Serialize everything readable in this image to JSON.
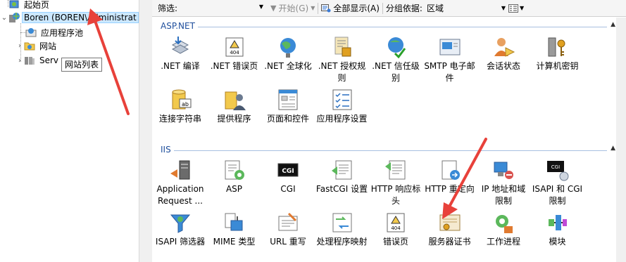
{
  "tree": {
    "items": [
      {
        "label": "起始页",
        "expanded": null
      },
      {
        "label": "Boren (BOREN\\Administrat",
        "expanded": true,
        "selected": true
      },
      {
        "label": "应用程序池",
        "expanded": null
      },
      {
        "label": "网站",
        "expanded": false
      },
      {
        "label": "Serv",
        "expanded": false
      }
    ],
    "tooltip": "网站列表"
  },
  "toolbar": {
    "filter_label": "筛选:",
    "go_label": "开始(G)",
    "show_all_label": "全部显示(A)",
    "group_by_label": "分组依据:",
    "group_by_value": "区域"
  },
  "groups": [
    {
      "title": "ASP.NET",
      "features": [
        {
          "label": ".NET 编译",
          "icon": "net-compile-icon"
        },
        {
          "label": ".NET 错误页",
          "icon": "net-error-pages-icon"
        },
        {
          "label": ".NET 全球化",
          "icon": "net-globalization-icon"
        },
        {
          "label": ".NET 授权规则",
          "icon": "net-authorization-icon"
        },
        {
          "label": ".NET 信任级别",
          "icon": "net-trust-levels-icon"
        },
        {
          "label": "SMTP 电子邮件",
          "icon": "smtp-email-icon"
        },
        {
          "label": "会话状态",
          "icon": "session-state-icon"
        },
        {
          "label": "计算机密钥",
          "icon": "machine-key-icon"
        },
        {
          "label": "连接字符串",
          "icon": "connection-strings-icon"
        },
        {
          "label": "提供程序",
          "icon": "providers-icon"
        },
        {
          "label": "页面和控件",
          "icon": "pages-controls-icon"
        },
        {
          "label": "应用程序设置",
          "icon": "app-settings-icon"
        }
      ]
    },
    {
      "title": "IIS",
      "features": [
        {
          "label": "Application Request ...",
          "icon": "arr-icon"
        },
        {
          "label": "ASP",
          "icon": "asp-icon"
        },
        {
          "label": "CGI",
          "icon": "cgi-icon"
        },
        {
          "label": "FastCGI 设置",
          "icon": "fastcgi-icon"
        },
        {
          "label": "HTTP 响应标头",
          "icon": "http-response-headers-icon"
        },
        {
          "label": "HTTP 重定向",
          "icon": "http-redirect-icon"
        },
        {
          "label": "IP 地址和域限制",
          "icon": "ip-restrictions-icon"
        },
        {
          "label": "ISAPI 和 CGI 限制",
          "icon": "isapi-cgi-restrictions-icon"
        },
        {
          "label": "ISAPI 筛选器",
          "icon": "isapi-filters-icon"
        },
        {
          "label": "MIME 类型",
          "icon": "mime-types-icon"
        },
        {
          "label": "URL 重写",
          "icon": "url-rewrite-icon"
        },
        {
          "label": "处理程序映射",
          "icon": "handler-mappings-icon"
        },
        {
          "label": "错误页",
          "icon": "error-pages-icon"
        },
        {
          "label": "服务器证书",
          "icon": "server-certificates-icon"
        },
        {
          "label": "工作进程",
          "icon": "worker-processes-icon"
        },
        {
          "label": "模块",
          "icon": "modules-icon"
        }
      ]
    }
  ],
  "colors": {
    "accent": "#1e4e9c",
    "annotation_red": "#e8413a",
    "selection": "#cce8ff"
  }
}
